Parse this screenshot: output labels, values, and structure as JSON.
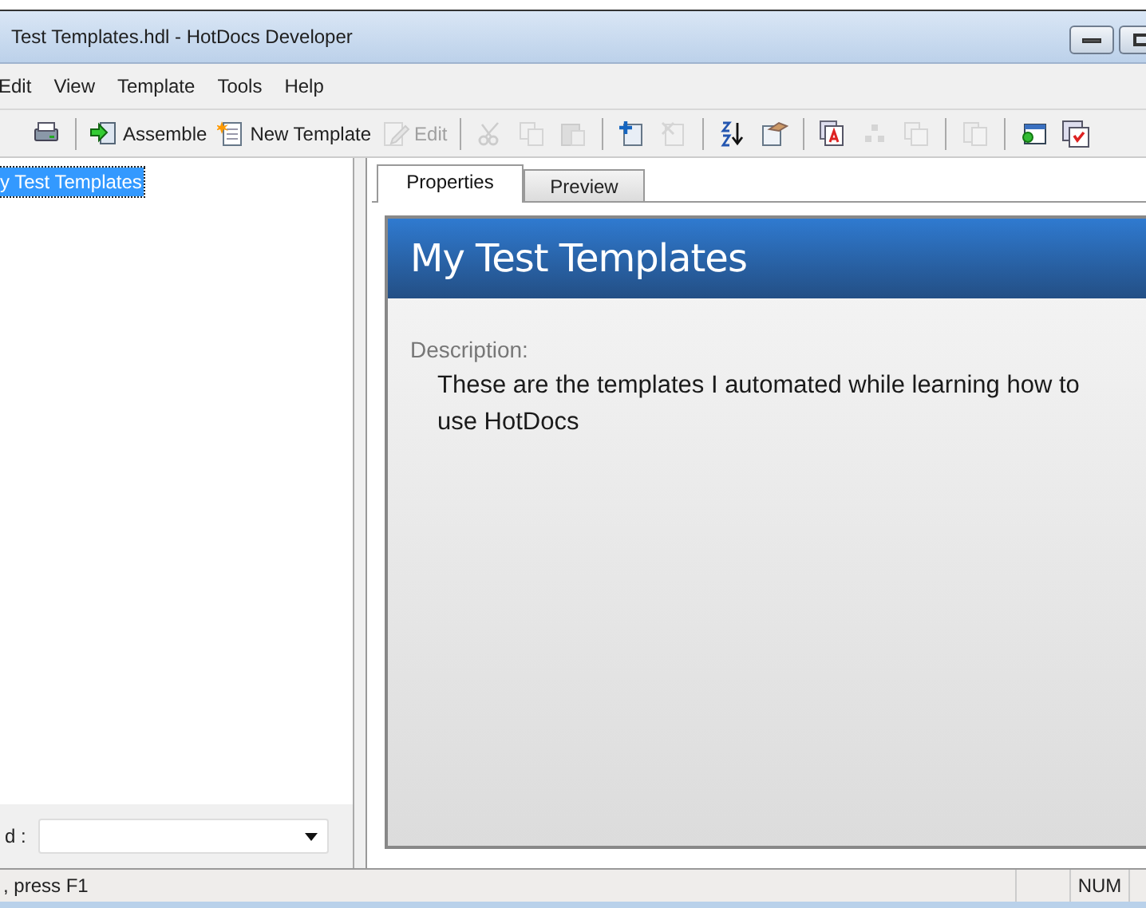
{
  "window": {
    "title": "Test Templates.hdl - HotDocs Developer"
  },
  "menu": [
    "Edit",
    "View",
    "Template",
    "Tools",
    "Help"
  ],
  "toolbar": [
    {
      "kind": "icon",
      "disabled": false
    },
    {
      "kind": "separator"
    },
    {
      "kind": "labeled",
      "label": "Assemble",
      "disabled": false
    },
    {
      "kind": "labeled",
      "label": "New Template",
      "disabled": false
    },
    {
      "kind": "labeled",
      "label": "Edit",
      "disabled": true
    },
    {
      "kind": "separator"
    },
    {
      "kind": "icon",
      "disabled": true
    },
    {
      "kind": "icon",
      "disabled": true
    },
    {
      "kind": "icon",
      "disabled": true
    },
    {
      "kind": "separator"
    },
    {
      "kind": "icon",
      "disabled": false
    },
    {
      "kind": "icon",
      "disabled": true
    },
    {
      "kind": "separator"
    },
    {
      "kind": "icon",
      "disabled": false
    },
    {
      "kind": "icon",
      "disabled": false
    },
    {
      "kind": "separator"
    },
    {
      "kind": "icon",
      "disabled": false
    },
    {
      "kind": "icon",
      "disabled": true
    },
    {
      "kind": "icon",
      "disabled": true
    },
    {
      "kind": "separator"
    },
    {
      "kind": "icon",
      "disabled": true
    },
    {
      "kind": "separator"
    },
    {
      "kind": "icon",
      "disabled": false
    },
    {
      "kind": "icon",
      "disabled": false
    }
  ],
  "tree": {
    "items": [
      {
        "label": "y Test Templates",
        "selected": true
      }
    ]
  },
  "filter": {
    "label": "d :"
  },
  "tabs": [
    {
      "label": "Properties",
      "selected": true
    },
    {
      "label": "Preview",
      "selected": false
    }
  ],
  "properties": {
    "title": "My Test Templates",
    "description_label": "Description:",
    "description": "These are the templates I automated while learning how to use HotDocs"
  },
  "status_bar": {
    "message": ", press F1",
    "indicators": [
      "NUM"
    ]
  }
}
